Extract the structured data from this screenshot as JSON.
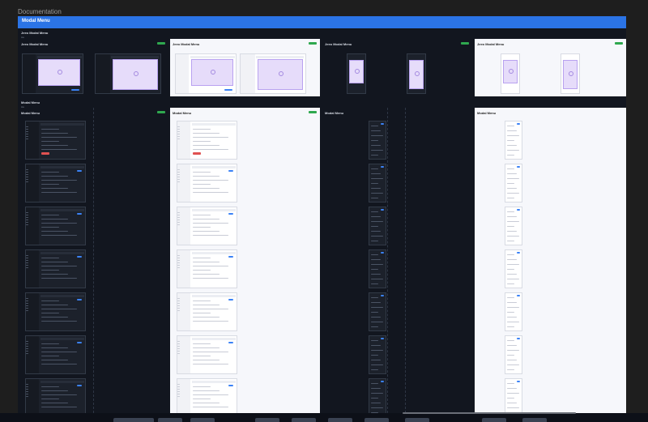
{
  "window": {
    "label": "Documentation"
  },
  "banner": {
    "title": "Modal Menu"
  },
  "sections": [
    {
      "title": "Jeeo Modal Menu",
      "subtitle": "Aa"
    },
    {
      "title": "Modal Menu",
      "subtitle": "Aa"
    }
  ],
  "frames_top": [
    {
      "title": "Jeeo Modal Menu",
      "theme": "dark"
    },
    {
      "title": "Jeeo Modal Menu",
      "theme": "light"
    },
    {
      "title": "Jeeo Modal Menu",
      "theme": "dark"
    },
    {
      "title": "Jeeo Modal Menu",
      "theme": "light"
    }
  ],
  "frames_bottom": [
    {
      "title": "Modal Menu",
      "theme": "dark"
    },
    {
      "title": "Modal Menu",
      "theme": "light"
    },
    {
      "title": "Modal Menu",
      "theme": "dark"
    },
    {
      "title": "Modal Menu",
      "theme": "light"
    }
  ],
  "colors": {
    "accent": "#2b74e6",
    "badge": "#2fa84f",
    "modal": "#e6dcfa",
    "danger": "#e05252"
  }
}
